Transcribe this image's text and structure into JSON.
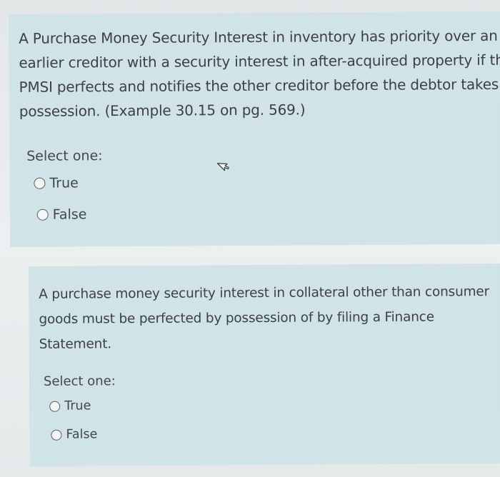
{
  "questions": [
    {
      "text_lines": [
        "A Purchase Money Security Interest in inventory has priority over an",
        "earlier creditor with a security interest in after-acquired property if the",
        "PMSI perfects and notifies the other creditor before the debtor takes",
        "possession. (Example 30.15 on pg. 569.)"
      ],
      "select_label": "Select one:",
      "options": [
        "True",
        "False"
      ]
    },
    {
      "text_lines": [
        "A purchase money security interest in collateral other than consumer",
        "goods must be perfected by possession of by filing  a Finance",
        "Statement."
      ],
      "select_label": "Select one:",
      "options": [
        "True",
        "False"
      ]
    }
  ],
  "cursor_icon": "mouse-pointer-icon"
}
